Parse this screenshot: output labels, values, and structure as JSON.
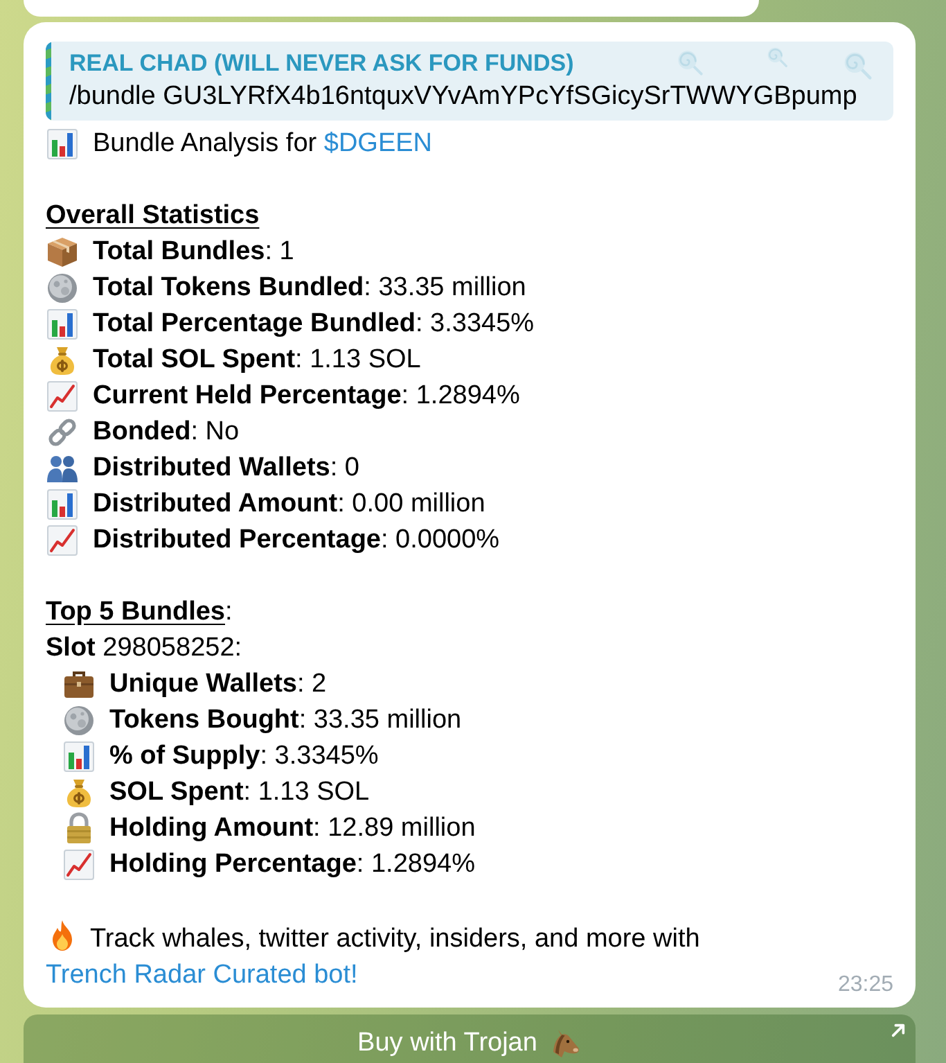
{
  "reply": {
    "author": "REAL CHAD (WILL NEVER ASK FOR FUNDS)",
    "text": "/bundle GU3LYRfX4b16ntquxVYvAmYPcYfSGicySrTWWYGBpump"
  },
  "intro": {
    "text": "Bundle Analysis for ",
    "link": "$DGEEN"
  },
  "overall": {
    "title": "Overall Statistics",
    "rows": [
      "**Total Bundles**: 1",
      "**Total Tokens Bundled**: 33.35 million",
      "**Total Percentage Bundled**: 3.3345%",
      "**Total SOL Spent**: 1.13 SOL",
      "**Current Held Percentage**: 1.2894%",
      "**Bonded**: No",
      "**Distributed Wallets**: 0",
      "**Distributed Amount**: 0.00 million",
      "**Distributed Percentage**: 0.0000%"
    ]
  },
  "top_bundles": {
    "title": "Top 5 Bundles",
    "title_suffix": ":",
    "slot": "**Slot** 298058252:",
    "rows": [
      "**Unique Wallets**: 2",
      "**Tokens Bought**: 33.35 million",
      "**% of Supply**: 3.3345%",
      "**SOL Spent**: 1.13 SOL",
      "**Holding Amount**: 12.89 million",
      "**Holding Percentage**: 1.2894%"
    ]
  },
  "promo": {
    "text": "Track whales, twitter activity, insiders, and more with ",
    "link": "Trench Radar Curated bot!"
  },
  "time": "23:25",
  "button": {
    "label": "Buy with Trojan"
  }
}
